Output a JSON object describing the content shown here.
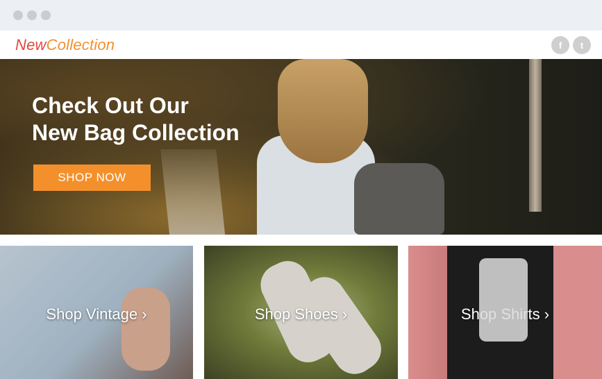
{
  "browser": {
    "window_controls": [
      "close-dot",
      "minimize-dot",
      "maximize-dot"
    ]
  },
  "nav": {
    "logo_part1": "New",
    "logo_part2": "Collection",
    "social": [
      {
        "name": "facebook-icon",
        "glyph": "f"
      },
      {
        "name": "twitter-icon",
        "glyph": "t"
      }
    ]
  },
  "hero": {
    "title_line1": "Check Out Our",
    "title_line2": "New Bag Collection",
    "cta_label": "SHOP NOW"
  },
  "tiles": [
    {
      "label": "Shop Vintage ›"
    },
    {
      "label": "Shop Shoes ›"
    },
    {
      "label": "Shop Shirts ›"
    }
  ],
  "colors": {
    "accent_orange": "#f4902c",
    "logo_red": "#e1483d",
    "chrome_bg": "#eceff3"
  }
}
